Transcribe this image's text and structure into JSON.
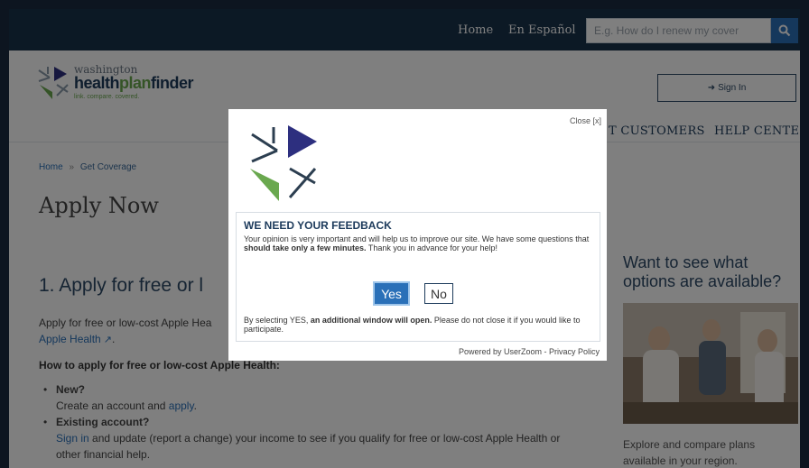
{
  "topbar": {
    "home": "Home",
    "spanish": "En Español",
    "search_placeholder": "E.g. How do I renew my cover"
  },
  "header": {
    "logo_line1": "washington",
    "logo_line2_a": "health",
    "logo_line2_b": "plan",
    "logo_line2_c": "finder",
    "logo_tagline": "link. compare. covered.",
    "signin": "Sign In",
    "nav_customers": "T CUSTOMERS",
    "nav_help": "HELP CENTER"
  },
  "main": {
    "breadcrumb_home": "Home",
    "breadcrumb_sep": "»",
    "breadcrumb_current": "Get Coverage",
    "title": "Apply Now",
    "section_title": "1. Apply for free or l",
    "intro": "Apply for free or low-cost Apple Hea",
    "intro_link": "Apple Health",
    "intro_end": ".",
    "how_to": "How to apply for free or low-cost Apple Health:",
    "new_label": "New?",
    "new_text": "Create an account and ",
    "new_link": "apply",
    "new_end": ".",
    "existing_label": "Existing account?",
    "existing_link": "Sign in",
    "existing_text": " and update (report a change) your income to see if you qualify for free or low-cost Apple Health or",
    "existing_text2": "other financial help."
  },
  "side": {
    "title": "Want to see what options are available?",
    "text": "Explore and compare plans available in your region."
  },
  "modal": {
    "close": "Close [x]",
    "title": "WE NEED YOUR FEEDBACK",
    "body_a": "Your opinion is very important and will help us to improve our site. We have some questions that ",
    "body_bold": "should take only a few minutes.",
    "body_b": " Thank you in advance for your help!",
    "yes": "Yes",
    "no": "No",
    "note_a": "By selecting YES, ",
    "note_bold": "an additional window will open.",
    "note_b": " Please do not close it if you would like to participate.",
    "powered": "Powered by UserZoom - Privacy Policy"
  },
  "colors": {
    "topbar": "#18324a",
    "brand_navy": "#1c3a5b",
    "brand_green": "#6aa84f",
    "accent_blue": "#2a70b8",
    "logo_purple": "#2d2f7f"
  }
}
